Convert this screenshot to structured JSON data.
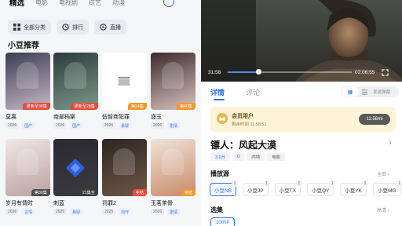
{
  "left": {
    "top_tabs": [
      "精选",
      "电影",
      "电视剧",
      "综艺",
      "动漫"
    ],
    "chips": [
      {
        "label": "全部分类",
        "icon": "grid-icon"
      },
      {
        "label": "排行",
        "icon": "rank-icon"
      },
      {
        "label": "直播",
        "icon": "live-icon"
      }
    ],
    "section_title": "小豆推荐",
    "cards": [
      {
        "title": "莫离",
        "badge": "更新至30集",
        "badge_type": "red",
        "year": "2026",
        "genre": "国产",
        "colors": [
          "#3a3d52",
          "#c9b8c8"
        ]
      },
      {
        "title": "南部档案",
        "badge": "更新至28集",
        "badge_type": "red",
        "year": "2026",
        "genre": "国产",
        "colors": [
          "#2b3b3a",
          "#7d9a8a"
        ]
      },
      {
        "title": "低智商犯罪",
        "badge": "第24集",
        "badge_type": "orange",
        "year": "2026",
        "genre": "悬疑",
        "colors": [
          "#ffffff",
          "#ffffff"
        ]
      },
      {
        "title": "逐玉",
        "badge": "第40集",
        "badge_type": "orange",
        "year": "2026",
        "genre": "剧情",
        "colors": [
          "#3b2a2c",
          "#d9c3c0"
        ]
      },
      {
        "title": "岁月有情时",
        "badge": "第30集",
        "badge_type": "gray",
        "year": "2026",
        "genre": "言情",
        "colors": [
          "#f1e6e6",
          "#b8a2a0"
        ]
      },
      {
        "title": "刺蓝",
        "badge": "21集全",
        "badge_type": "gray",
        "year": "2025",
        "genre": "悬疑",
        "colors": [
          "#2a2a2e",
          "#3a3a40"
        ]
      },
      {
        "title": "罚罪2",
        "badge": "完结",
        "badge_type": "red",
        "year": "2025",
        "genre": "动作",
        "colors": [
          "#2e2420",
          "#6e5848"
        ]
      },
      {
        "title": "玉茗茶骨",
        "badge": "完结",
        "badge_type": "orange",
        "year": "2026",
        "genre": "剧情",
        "colors": [
          "#efe3d8",
          "#c88a6a"
        ]
      }
    ]
  },
  "right": {
    "video": {
      "current_time": "31:58",
      "total_time": "02:06:55",
      "progress": 0.25
    },
    "tabs": [
      "详情",
      "评论"
    ],
    "danmu": {
      "toggle_label": "弹",
      "send_label": "发送弹幕"
    },
    "vip": {
      "title": "会员用户",
      "expire": "剩余时间 11:58:51",
      "button": "11:58ml"
    },
    "show": {
      "title": "镖人：风起大漠",
      "meta": [
        "3.0分",
        "0",
        "内地",
        "电影"
      ]
    },
    "sources": {
      "title": "播放源",
      "all_label": "全部",
      "items": [
        {
          "label": "小豆NB",
          "num": "1",
          "active": true
        },
        {
          "label": "小豆JP",
          "num": "1",
          "active": false
        },
        {
          "label": "小豆TX",
          "num": "1",
          "active": false
        },
        {
          "label": "小豆QY",
          "num": "1",
          "active": false
        },
        {
          "label": "小豆YK",
          "num": "1",
          "active": false
        },
        {
          "label": "小豆MG",
          "num": "1",
          "active": false
        }
      ]
    },
    "episodes": {
      "title": "选集",
      "all_label": "高清",
      "items": [
        "1080P"
      ]
    }
  },
  "colors": {
    "accent": "#2f74ff",
    "badge_red": "#e84b3c",
    "badge_orange": "#f0992f",
    "vip_bg": "#fdf3d8"
  }
}
